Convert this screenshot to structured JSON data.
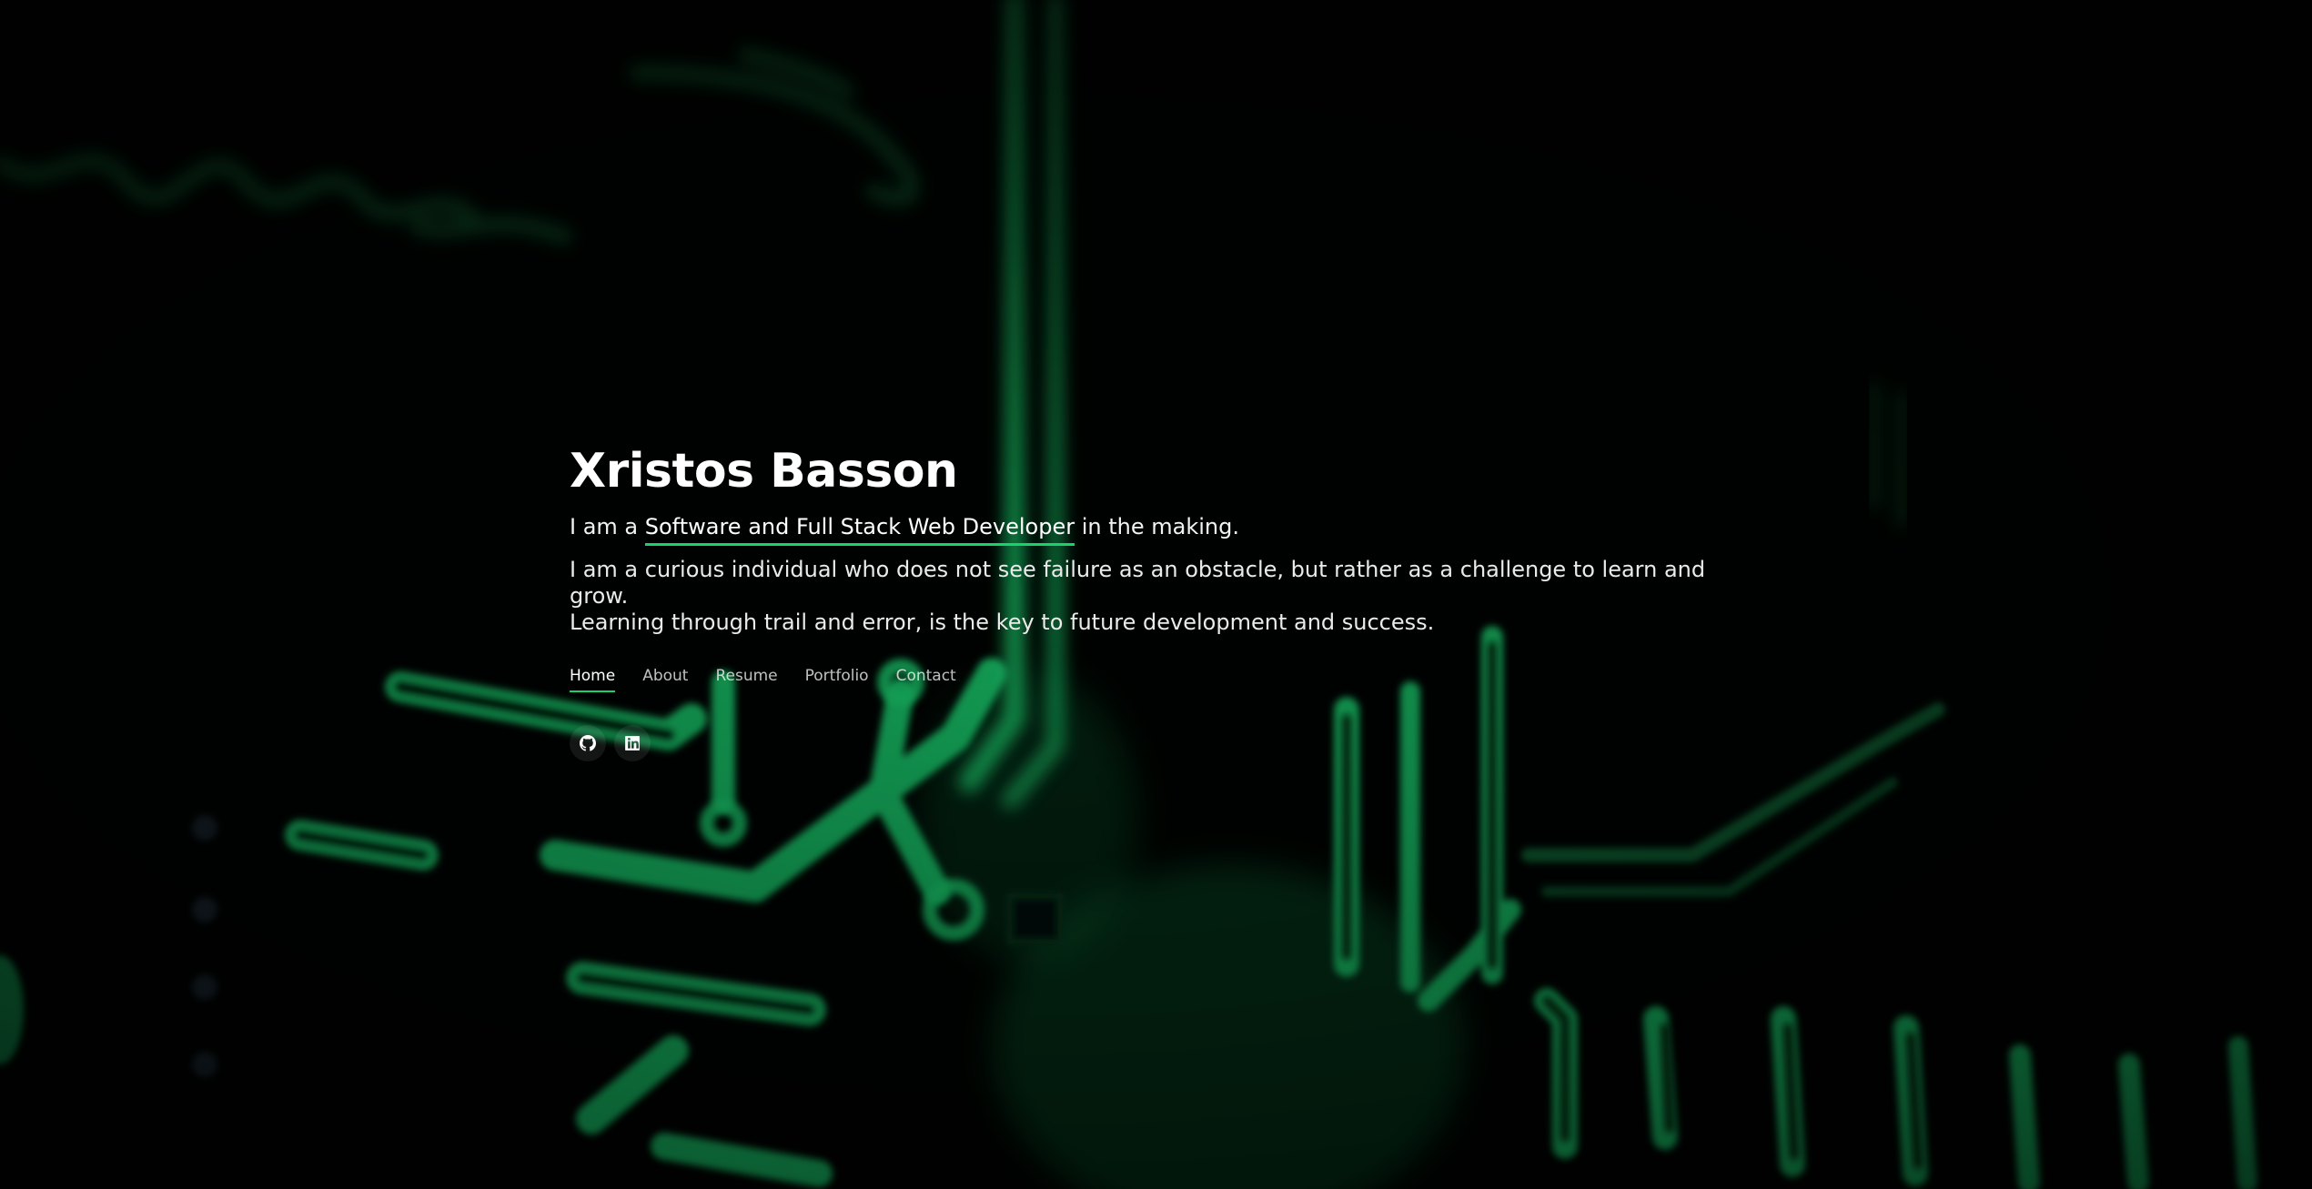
{
  "hero": {
    "name": "Xristos Basson",
    "tagline_prefix": "I am a ",
    "tagline_role": "Software and Full Stack Web Developer",
    "tagline_suffix": " in the making.",
    "bio_line1": "I am a curious individual who does not see failure as an obstacle, but rather as a challenge to learn and grow.",
    "bio_line2": "Learning through trail and error, is the key to future development and success."
  },
  "nav": {
    "items": [
      {
        "label": "Home",
        "active": true
      },
      {
        "label": "About",
        "active": false
      },
      {
        "label": "Resume",
        "active": false
      },
      {
        "label": "Portfolio",
        "active": false
      },
      {
        "label": "Contact",
        "active": false
      }
    ]
  },
  "social": {
    "items": [
      {
        "icon": "github-icon"
      },
      {
        "icon": "linkedin-icon"
      }
    ]
  },
  "theme": {
    "accent": "#18d26e",
    "background": "#000000",
    "circuit_green": "#1fe57a"
  }
}
